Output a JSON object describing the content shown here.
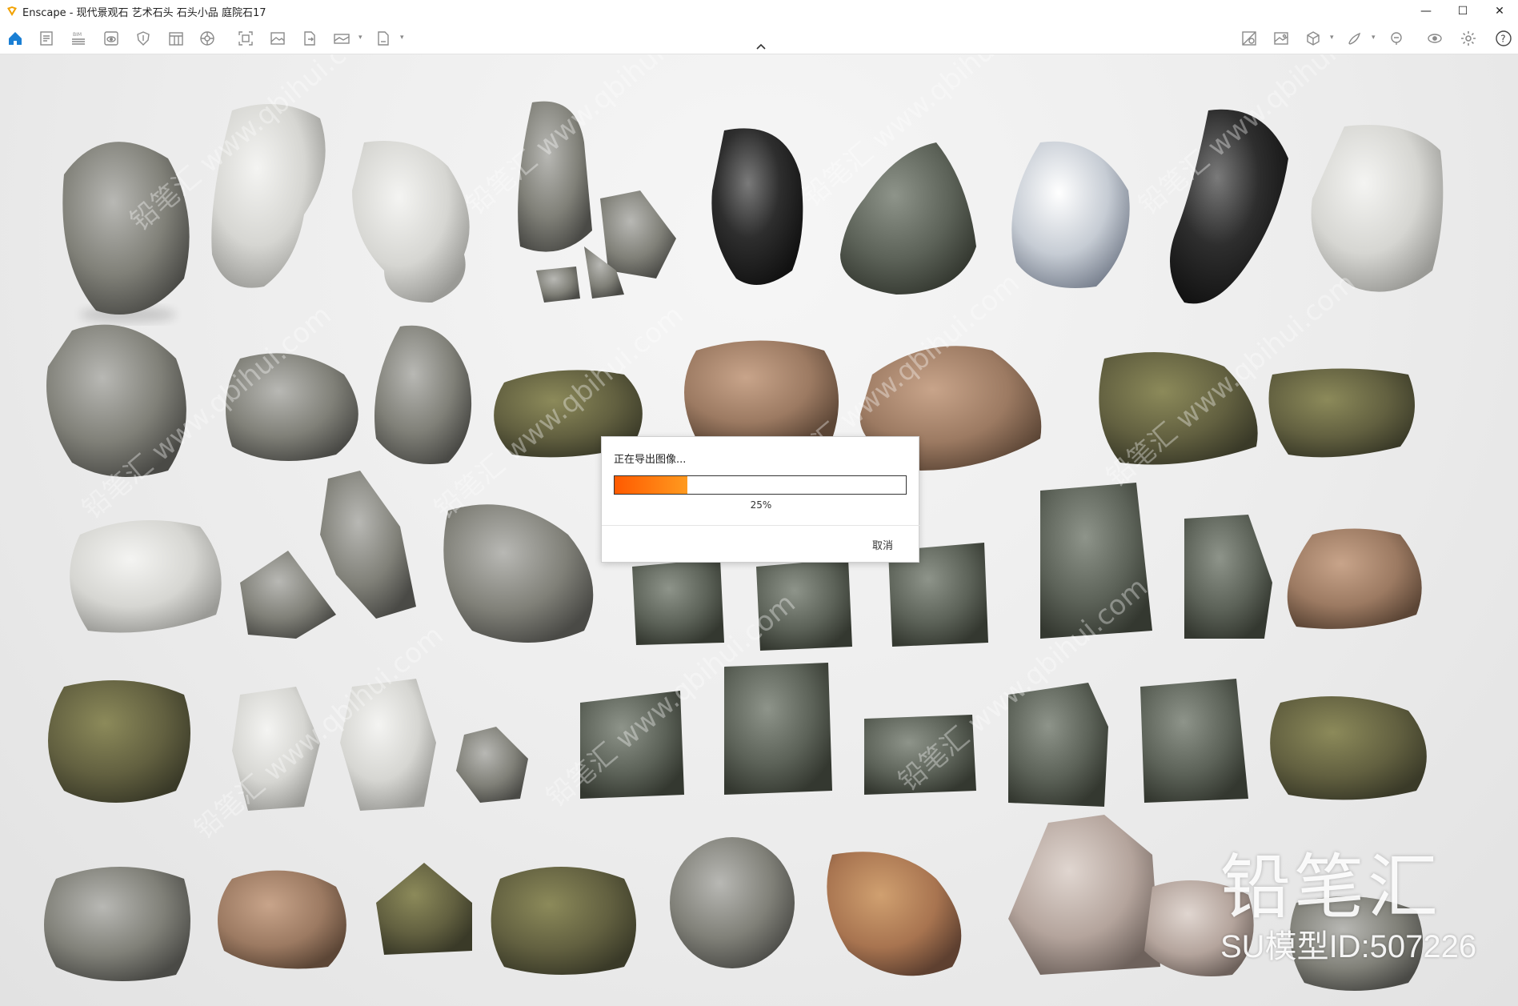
{
  "window": {
    "title": "Enscape - 现代景观石 艺术石头 石头小品 庭院石17",
    "minimize_glyph": "—",
    "maximize_glyph": "☐",
    "close_glyph": "✕"
  },
  "toolbar": {
    "left_icons": [
      "home-icon",
      "document-icon",
      "bim-icon",
      "eye-window-icon",
      "shield-icon",
      "panel-icon",
      "asset-library-icon",
      "screenshot-icon",
      "image-icon",
      "export-file-icon",
      "panorama-icon",
      "exe-export-icon"
    ],
    "bim_label": "BIM",
    "right_icons": [
      "views-icon",
      "gallery-icon",
      "cube-icon",
      "paint-icon",
      "feedback-icon",
      "visibility-icon",
      "settings-icon",
      "help-icon"
    ],
    "help_glyph": "?"
  },
  "dialog": {
    "title": "正在导出图像...",
    "progress_percent": 25,
    "progress_label": "25%",
    "cancel_label": "取消"
  },
  "watermark": {
    "brand": "铅笔汇",
    "model_id": "SU模型ID:507226",
    "diagonal": "铅笔汇 www.qbihui.com"
  },
  "colors": {
    "accent_blue": "#1a7fd4",
    "progress_start": "#ff5a00",
    "progress_end": "#ff9a1f",
    "logo": "#f2a200"
  }
}
